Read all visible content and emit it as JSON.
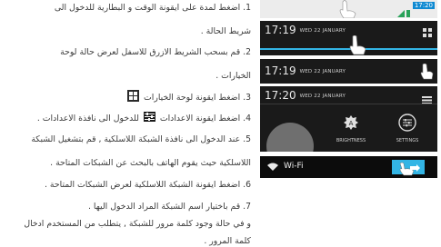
{
  "steps": [
    "1. اضغط لمدة على ايقونة الوقت و البطارية للدخول الى",
    "شريط الحالة .",
    "2. قم بسحب الشريط الازرق للاسفل لعرض حالة لوحة",
    "الخيارات .",
    "3. اضغط ايقونة لوحة الخيارات",
    "4. اضغط ايقونة الاعدادات",
    "للدخول الى نافذة الاعدادات .",
    "5. عند الدخول الى نافذة الشبكة اللاسلكية , قم بتشغيل الشبكة",
    "اللاسلكية حيث يقوم الهاتف بالبحث عن الشبكات المتاحة .",
    "6. اضغط ايقونة الشبكة اللاسلكية لعرض الشبكات المتاحة .",
    "7. قم باختيار اسم الشبكة المراد الدخول اليها .",
    "و في حالة وجود كلمة مرور للشبكة , يتطلب من المستخدم ادخال",
    "كلمة المرور ."
  ],
  "screens": {
    "status_time": "17:20",
    "s1_time": "17:19",
    "s1_date": "WED 22 JANUARY",
    "s2_time": "17:19",
    "s2_date": "WED 22 JANUARY",
    "s3_time": "17:20",
    "s3_date": "WED 22 JANUARY",
    "brightness_label": "BRIGHTNESS",
    "settings_label": "SETTINGS",
    "wifi_label": "Wi-Fi"
  },
  "colors": {
    "accent_blue": "#33b5e5",
    "panel_dark": "#1a1a1a",
    "status_blue": "#0f8ad2"
  }
}
